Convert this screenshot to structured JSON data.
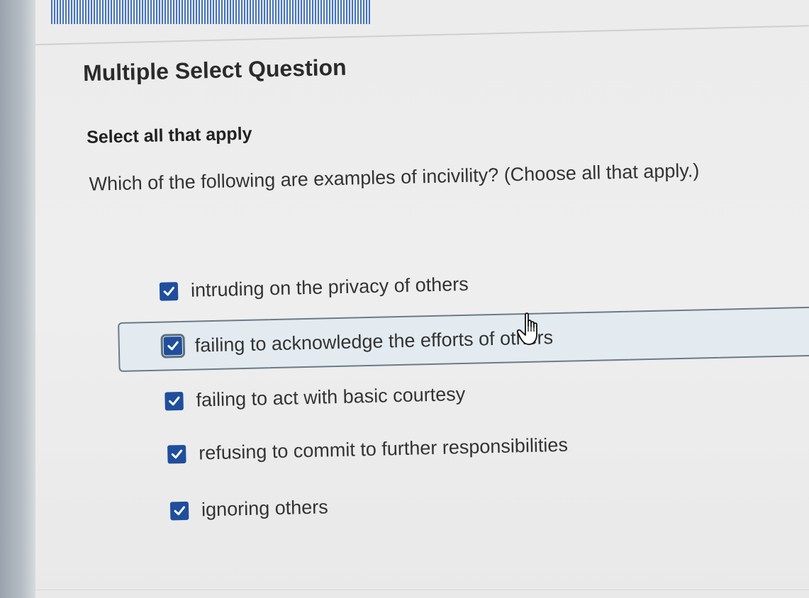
{
  "question": {
    "type_label": "Multiple Select Question",
    "instruction": "Select all that apply",
    "prompt": "Which of the following are examples of incivility? (Choose all that apply.)"
  },
  "options": [
    {
      "label": "intruding on the privacy of others",
      "checked": true
    },
    {
      "label": "failing to acknowledge the efforts of others",
      "checked": true,
      "focused": true
    },
    {
      "label": "failing to act with basic courtesy",
      "checked": true
    },
    {
      "label": "refusing to commit to further responsibilities",
      "checked": true
    },
    {
      "label": "ignoring others",
      "checked": true
    }
  ],
  "colors": {
    "checkbox": "#1f4e9c",
    "highlight_bg": "#e4ebf0",
    "highlight_border": "#6a7b88",
    "text": "#333333"
  },
  "icons": {
    "check": "checkmark-icon",
    "cursor": "hand-pointer-icon"
  }
}
